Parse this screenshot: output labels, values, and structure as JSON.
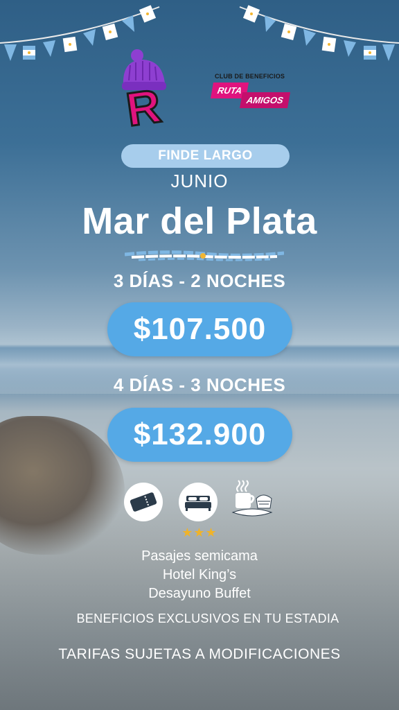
{
  "brand": {
    "club_title": "CLUB DE BENEFICIOS",
    "club_word1": "RUTA",
    "club_word2": "AMIGOS",
    "logo_letter": "R"
  },
  "promo": {
    "badge": "FINDE LARGO",
    "month": "JUNIO",
    "destination": "Mar del Plata"
  },
  "packages": [
    {
      "duration": "3 DÍAS - 2 NOCHES",
      "price": "$107.500"
    },
    {
      "duration": "4 DÍAS - 3 NOCHES",
      "price": "$132.900"
    }
  ],
  "amenities": {
    "icons": [
      "ticket-icon",
      "bed-icon",
      "breakfast-icon"
    ],
    "stars": "★★★",
    "hotel_stars": 3,
    "lines": [
      "Pasajes semicama",
      "Hotel King’s",
      "Desayuno Buffet"
    ]
  },
  "footer": {
    "benefits": "BENEFICIOS EXCLUSIVOS EN TU ESTADIA",
    "disclaimer": "TARIFAS SUJETAS A MODIFICACIONES"
  },
  "colors": {
    "pill_bg": "#a7cdec",
    "price_bg": "#55a9e6",
    "brand_pink": "#e0137e",
    "hat_purple": "#8e3fd1",
    "star_gold": "#f0b329"
  }
}
